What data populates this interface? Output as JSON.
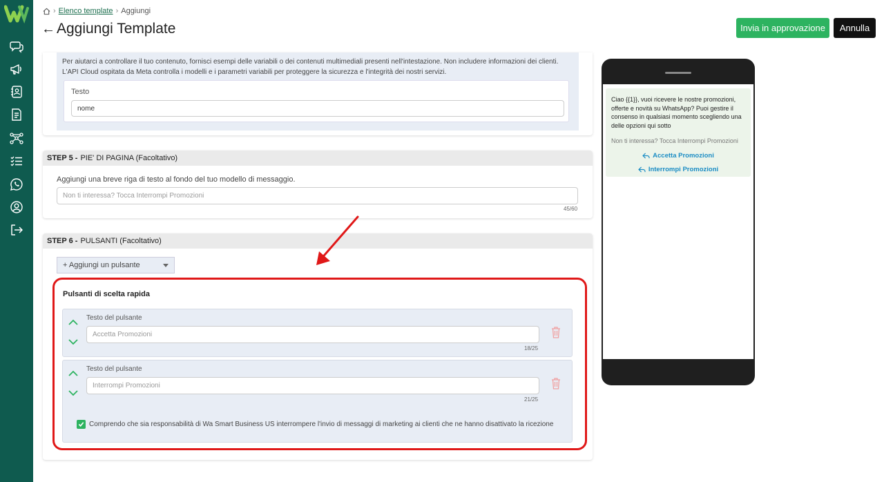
{
  "colors": {
    "sidebar": "#0f5b4f",
    "accent": "#2db360",
    "annotation": "#e01818",
    "link": "#1a8cc4"
  },
  "breadcrumb": {
    "home_icon": "home-icon",
    "link": "Elenco template",
    "current": "Aggiungi"
  },
  "header": {
    "title": "Aggiungi Template",
    "approve_label": "Invia in approvazione",
    "cancel_label": "Annulla"
  },
  "sidebar": {
    "items": [
      "chat-icon",
      "megaphone-icon",
      "contacts-icon",
      "document-icon",
      "flow-icon",
      "checklist-icon",
      "whatsapp-icon",
      "user-icon",
      "logout-icon"
    ]
  },
  "variables": {
    "info": "Per aiutarci a controllare il tuo contenuto, fornisci esempi delle variabili o dei contenuti multimediali presenti nell'intestazione. Non includere informazioni dei clienti. L'API Cloud ospitata da Meta controlla i modelli e i parametri variabili per proteggere la sicurezza e l'integrità dei nostri servizi.",
    "field_label": "Testo",
    "field_value": "nome"
  },
  "step5": {
    "step": "STEP 5 -",
    "title": "PIE' DI PAGINA (Facoltativo)",
    "description": "Aggiungi una breve riga di testo al fondo del tuo modello di messaggio.",
    "placeholder": "Non ti interessa? Tocca Interrompi Promozioni",
    "counter": "45/60"
  },
  "step6": {
    "step": "STEP 6 -",
    "title": "PULSANTI (Facoltativo)",
    "add_button": "+ Aggiungi un pulsante",
    "quick_title": "Pulsanti di scelta rapida",
    "buttons": [
      {
        "label": "Testo del pulsante",
        "value": "Accetta Promozioni",
        "counter": "18/25"
      },
      {
        "label": "Testo del pulsante",
        "value": "Interrompi Promozioni",
        "counter": "21/25"
      }
    ],
    "consent": "Comprendo che sia responsabilità di Wa Smart Business US interrompere l'invio di messaggi di marketing ai clienti che ne hanno disattivato la ricezione"
  },
  "preview": {
    "body": "Ciao {{1}}, vuoi ricevere le nostre promozioni, offerte e novità su WhatsApp? Puoi gestire il consenso in qualsiasi momento scegliendo una delle opzioni qui sotto",
    "footer": "Non ti interessa? Tocca Interrompi Promozioni",
    "replies": [
      "Accetta Promozioni",
      "Interrompi Promozioni"
    ]
  }
}
